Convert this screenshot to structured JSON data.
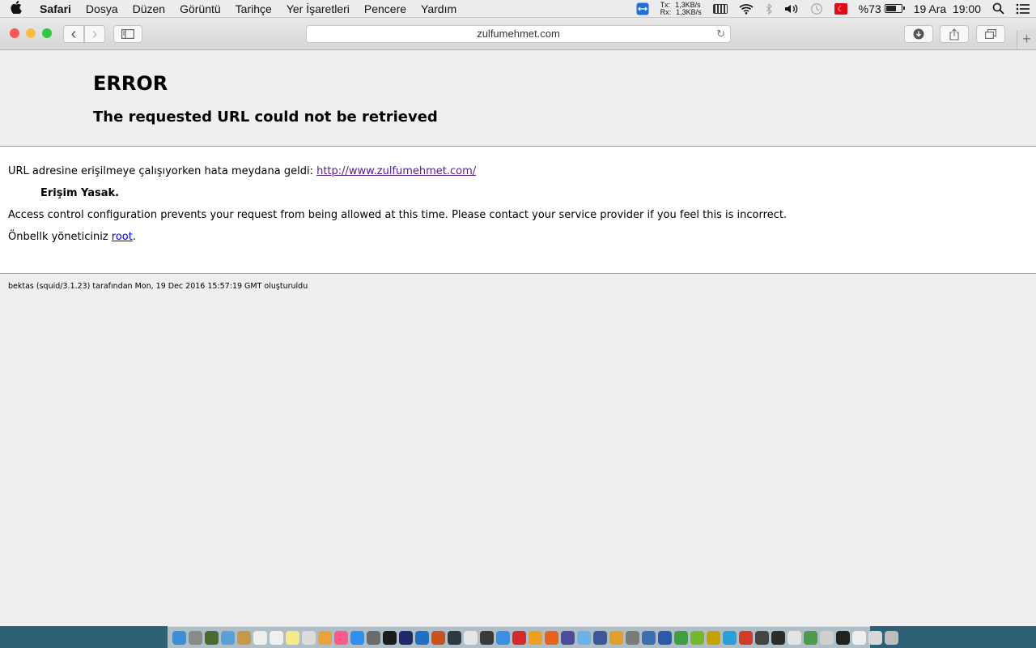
{
  "menubar": {
    "apple_icon": "",
    "app_name": "Safari",
    "items": [
      "Dosya",
      "Düzen",
      "Görüntü",
      "Tarihçe",
      "Yer İşaretleri",
      "Pencere",
      "Yardım"
    ],
    "net_tx_label": "Tx:",
    "net_rx_label": "Rx:",
    "net_tx": "1,3KB/s",
    "net_rx": "1,3KB/s",
    "battery": "%73",
    "date": "19 Ara",
    "time": "19:00"
  },
  "toolbar": {
    "back_icon": "‹",
    "forward_icon": "›",
    "address": "zulfumehmet.com",
    "reload_icon": "↻",
    "new_tab_icon": "+"
  },
  "page": {
    "title": "ERROR",
    "subtitle": "The requested URL could not be retrieved",
    "line1_prefix": "URL adresine erişilmeye çalışıyorken hata meydana geldi: ",
    "line1_link": "http://www.zulfumehmet.com/",
    "line2": "Erişim Yasak.",
    "line3": "Access control configuration prevents your request from being allowed at this time. Please contact your service provider if you feel this is incorrect.",
    "line4_prefix": "Önbellk yöneticiniz ",
    "line4_link": "root",
    "line4_suffix": ".",
    "footer": "bektas (squid/3.1.23) tarafından Mon, 19 Dec 2016 15:57:19 GMT oluşturuldu"
  },
  "colors": {
    "close": "#fc5753",
    "minimize": "#fdbc40",
    "zoom": "#33c748",
    "visited_link": "#551a8b",
    "link": "#0000ee"
  },
  "dock": {
    "icon_colors": [
      "#3b8fd6",
      "#8a8a8a",
      "#4a6b2f",
      "#5aa0d8",
      "#c49a4a",
      "#eeeeee",
      "#f0f0f0",
      "#f5e98a",
      "#dcdcdc",
      "#e8a33c",
      "#fc5a8d",
      "#2f8ef0",
      "#6b6b6b",
      "#1b1b1b",
      "#1e2a6b",
      "#1f6fc4",
      "#c9531f",
      "#2d3940",
      "#e6e6e6",
      "#3a3a3a",
      "#3a8ee6",
      "#d42a2a",
      "#f0a020",
      "#e8621c",
      "#4c4c9a",
      "#6bb2e8",
      "#3b5998",
      "#e0a02a",
      "#7a7a7a",
      "#3c6fb0",
      "#2b5aa8",
      "#3f9f3f",
      "#76b82a",
      "#c7a100",
      "#2aa0d8",
      "#d23a2a",
      "#444444",
      "#2c2c2c",
      "#e4e4e4",
      "#4c9a4c",
      "#cfcfcf",
      "#222222",
      "#eeeeee",
      "#d8d8d8",
      "#bdbdbd"
    ]
  }
}
